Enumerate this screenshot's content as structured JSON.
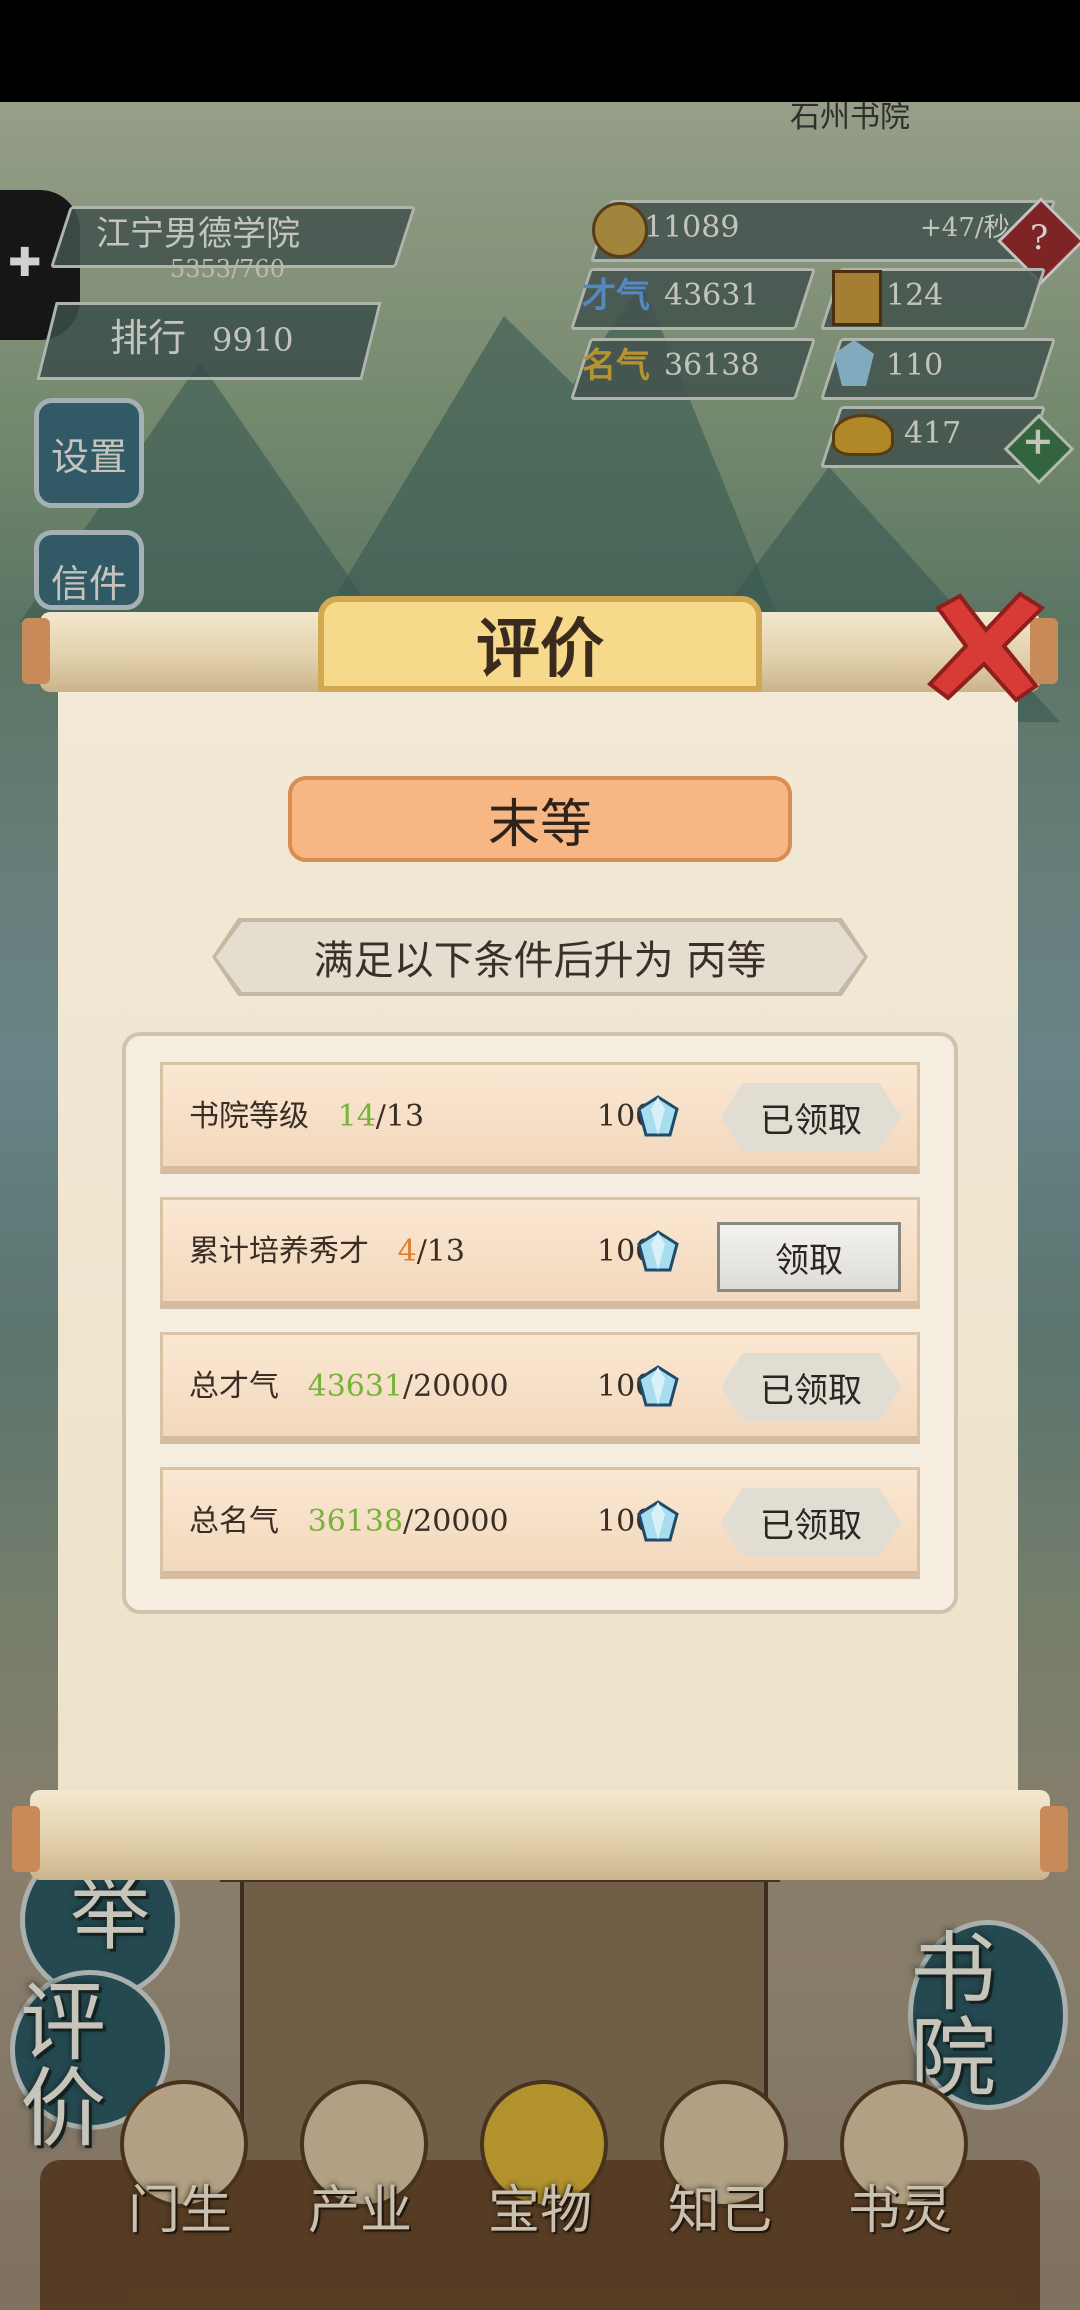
{
  "academy": {
    "name": "江宁男德学院",
    "exp": "5353/760",
    "rank_label": "排行",
    "rank_value": "9910",
    "nearby_name": "石州书院"
  },
  "resources": {
    "coins": "11089",
    "coin_rate": "+47/秒",
    "talent_label": "才气",
    "talent_value": "43631",
    "box_value": "124",
    "fame_label": "名气",
    "fame_value": "36138",
    "gems": "110",
    "ingots": "417"
  },
  "side_menu": {
    "settings": "设置",
    "mail": "信件"
  },
  "bottom_left": {
    "exam": "举",
    "evaluate": "评价"
  },
  "bottom_right": {
    "academy": "书院"
  },
  "bottom_nav": [
    {
      "label": "门生"
    },
    {
      "label": "产业"
    },
    {
      "label": "宝物"
    },
    {
      "label": "知己"
    },
    {
      "label": "书灵"
    }
  ],
  "modal": {
    "title": "评价",
    "current_grade": "末等",
    "condition_text": "满足以下条件后升为 丙等",
    "tasks": [
      {
        "label": "书院等级",
        "progress": "14",
        "target": "/13",
        "reward": "100",
        "button": "已领取",
        "claimed": true
      },
      {
        "label": "累计培养秀才",
        "progress": "4",
        "target": "/13",
        "reward": "100",
        "button": "领取",
        "claimed": false
      },
      {
        "label": "总才气",
        "progress": "43631",
        "target": "/20000",
        "reward": "100",
        "button": "已领取",
        "claimed": true
      },
      {
        "label": "总名气",
        "progress": "36138",
        "target": "/20000",
        "reward": "100",
        "button": "已领取",
        "claimed": true
      }
    ]
  },
  "colors": {
    "progress_done": "#77b33a",
    "progress_pending": "#de7f2c",
    "close_x": "#d83a36"
  }
}
